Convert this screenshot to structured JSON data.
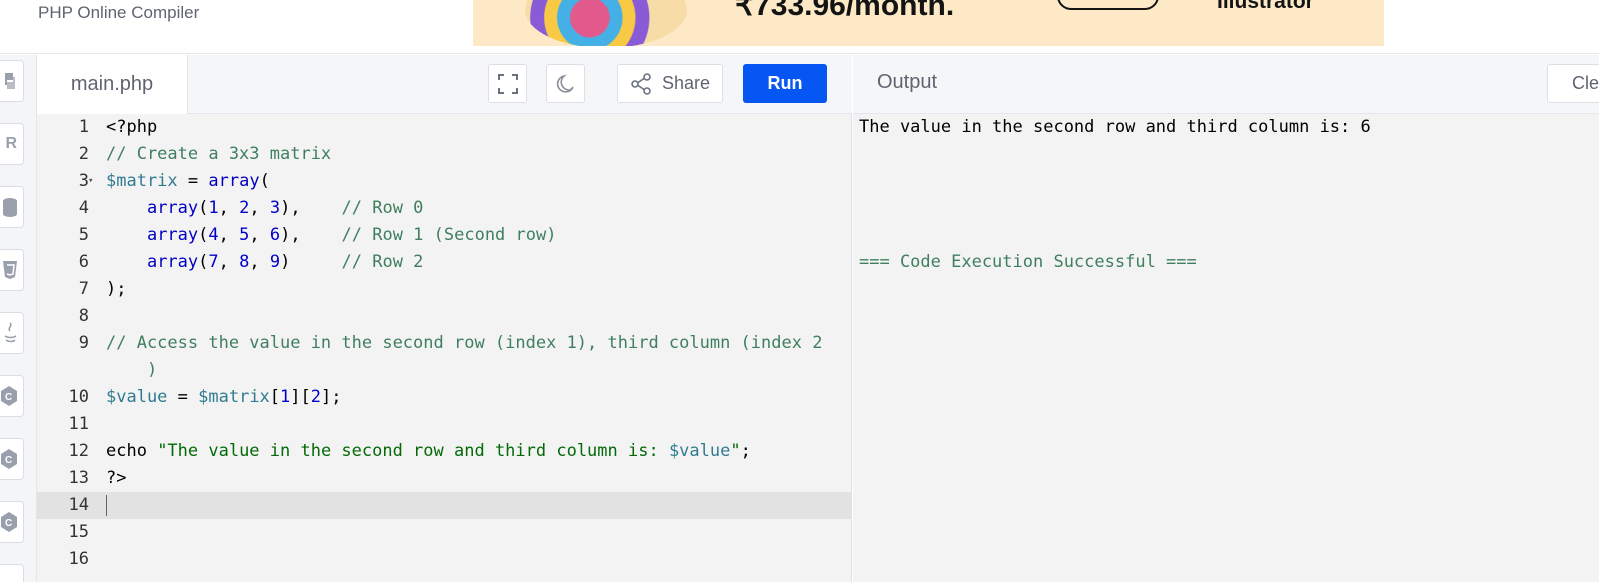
{
  "header": {
    "brand": "PHP Online Compiler"
  },
  "ad": {
    "price_text": "₹733.96/month.",
    "brand_text": "Illustrator"
  },
  "rail": {
    "icons": [
      "python-icon",
      "r-icon",
      "database-icon",
      "html5-icon",
      "java-icon",
      "c-icon",
      "cpp-icon",
      "csharp-icon"
    ]
  },
  "editor": {
    "filename": "main.php",
    "share_label": "Share",
    "run_label": "Run",
    "line_numbers": [
      "1",
      "2",
      "3",
      "4",
      "5",
      "6",
      "7",
      "8",
      "9",
      "",
      "10",
      "11",
      "12",
      "13",
      "14",
      "15",
      "16"
    ],
    "active_line": "14",
    "lines": [
      "<?php",
      "// Create a 3x3 matrix",
      "$matrix = array(",
      "    array(1, 2, 3),    // Row 0",
      "    array(4, 5, 6),    // Row 1 (Second row)",
      "    array(7, 8, 9)     // Row 2",
      ");",
      "",
      "// Access the value in the second row (index 1), third column (index 2",
      "    )",
      "$value = $matrix[1][2];",
      "",
      "echo \"The value in the second row and third column is: $value\";",
      "?>",
      "",
      "",
      ""
    ]
  },
  "output": {
    "title": "Output",
    "clear_label": "Clear",
    "result_line": "The value in the second row and third column is: 6",
    "success_line": "=== Code Execution Successful ==="
  }
}
